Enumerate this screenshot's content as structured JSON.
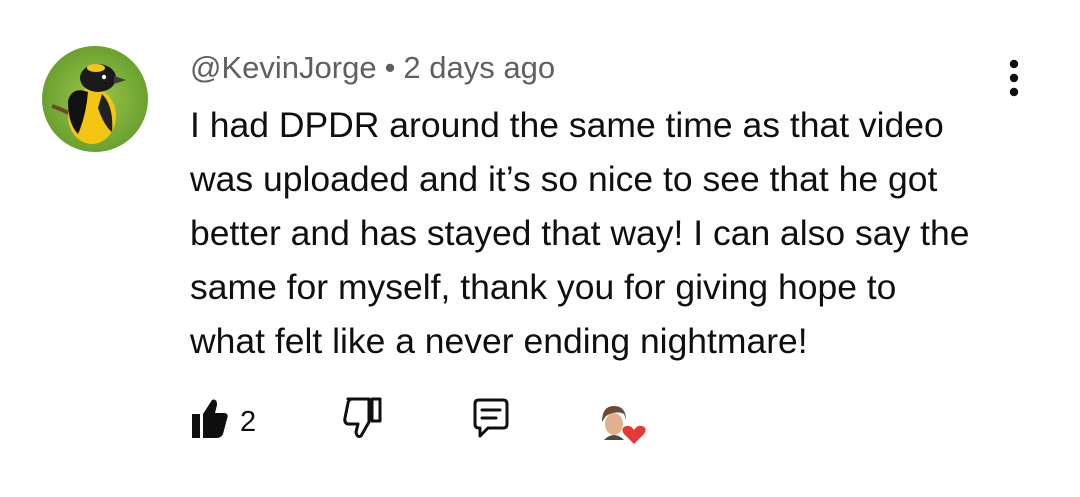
{
  "comment": {
    "author": "@KevinJorge",
    "separator": "•",
    "timestamp": "2 days ago",
    "text_lines": [
      "I had DPDR around the same time as that video",
      "was uploaded and it’s so nice to see that he got",
      "better and has stayed that way! I can also say the",
      "same for myself, thank you for giving hope to",
      "what felt like a never ending nightmare!"
    ],
    "like_count": "2"
  },
  "icons": {
    "avatar": "bird-avatar",
    "menu": "more-vert-icon",
    "like": "thumb-up-filled-icon",
    "dislike": "thumb-down-outline-icon",
    "reply": "comment-icon",
    "creator_heart": "creator-heart-icon"
  },
  "colors": {
    "text": "#0f0f0f",
    "secondary_text": "#606060",
    "heart": "#e53935"
  }
}
